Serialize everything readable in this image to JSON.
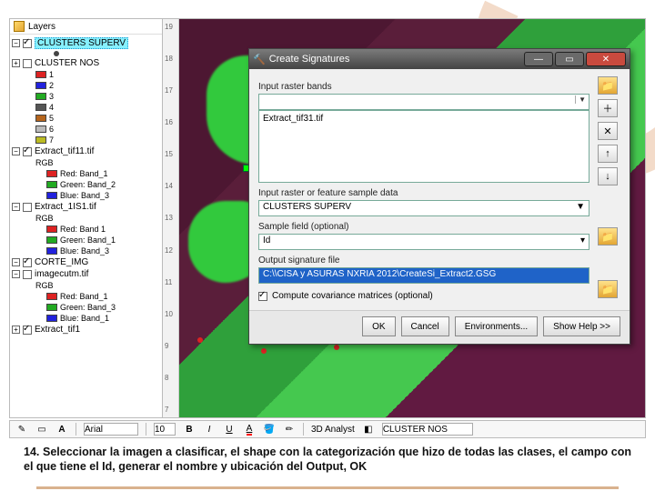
{
  "layers": {
    "title": "Layers",
    "items": [
      {
        "label": "CLUSTERS SUPERV",
        "checked": true,
        "expanded": true,
        "type": "group",
        "highlight": true,
        "children": [
          {
            "type": "dot"
          }
        ]
      },
      {
        "label": "CLUSTER NOS",
        "checked": false,
        "expanded": false,
        "type": "group",
        "children": [
          {
            "type": "class",
            "color": "#d22",
            "label": "1"
          },
          {
            "type": "class",
            "color": "#22d",
            "label": "2"
          },
          {
            "type": "class",
            "color": "#2a2",
            "label": "3"
          },
          {
            "type": "class",
            "color": "#555",
            "label": "4"
          },
          {
            "type": "class",
            "color": "#b5651d",
            "label": "5"
          },
          {
            "type": "class",
            "color": "#bbb",
            "label": "6"
          },
          {
            "type": "class",
            "color": "#bb2",
            "label": "7"
          }
        ]
      },
      {
        "label": "Extract_tif11.tif",
        "checked": true,
        "expanded": true,
        "type": "raster",
        "children": [
          {
            "type": "rgbhdr",
            "label": "RGB"
          },
          {
            "type": "band",
            "color": "#d22",
            "label": "Red: Band_1"
          },
          {
            "type": "band",
            "color": "#2a2",
            "label": "Green: Band_2"
          },
          {
            "type": "band",
            "color": "#22d",
            "label": "Blue: Band_3"
          }
        ]
      },
      {
        "label": "Extract_1IS1.tif",
        "checked": false,
        "expanded": true,
        "type": "raster",
        "children": [
          {
            "type": "rgbhdr",
            "label": "RGB"
          },
          {
            "type": "band",
            "color": "#d22",
            "label": "Red: Band 1"
          },
          {
            "type": "band",
            "color": "#2a2",
            "label": "Green: Band_1"
          },
          {
            "type": "band",
            "color": "#22d",
            "label": "Blue: Band_3"
          }
        ]
      },
      {
        "label": "CORTE_IMG",
        "checked": true,
        "expanded": true,
        "type": "group",
        "children": []
      },
      {
        "label": "imagecutm.tif",
        "checked": false,
        "expanded": true,
        "type": "raster",
        "children": [
          {
            "type": "rgbhdr",
            "label": "RGB"
          },
          {
            "type": "band",
            "color": "#d22",
            "label": "Red: Band_1"
          },
          {
            "type": "band",
            "color": "#2a2",
            "label": "Green: Band_3"
          },
          {
            "type": "band",
            "color": "#22d",
            "label": "Blue: Band_1"
          }
        ]
      },
      {
        "label": "Extract_tif1",
        "checked": true,
        "expanded": false,
        "type": "raster"
      }
    ]
  },
  "ruler_ticks": [
    "19",
    "18",
    "17",
    "16",
    "15",
    "14",
    "13",
    "12",
    "11",
    "10",
    "9",
    "8",
    "7"
  ],
  "dialog": {
    "title": "Create Signatures",
    "labels": {
      "input_bands": "Input raster bands",
      "sample_data": "Input raster or feature sample data",
      "sample_field": "Sample field (optional)",
      "output_sig": "Output signature file",
      "covariance": "Compute covariance matrices (optional)"
    },
    "listbox_item": "Extract_tif31.tif",
    "sample_data_value": "CLUSTERS SUPERV",
    "sample_field_value": "Id",
    "output_value": "C:\\\\CISA y ASURAS NXRIA 2012\\CreateSi_Extract2.GSG",
    "covariance_checked": true,
    "buttons": {
      "ok": "OK",
      "cancel": "Cancel",
      "env": "Environments...",
      "help": "Show Help >>"
    }
  },
  "toolbar": {
    "font": "Arial",
    "size": "10",
    "analyst": "3D Analyst",
    "layer": "CLUSTER NOS"
  },
  "caption": "14. Seleccionar la imagen a clasificar, el shape con la categorización que hizo de todas las clases, el campo con el que tiene el Id, generar el nombre y ubicación del Output, OK"
}
